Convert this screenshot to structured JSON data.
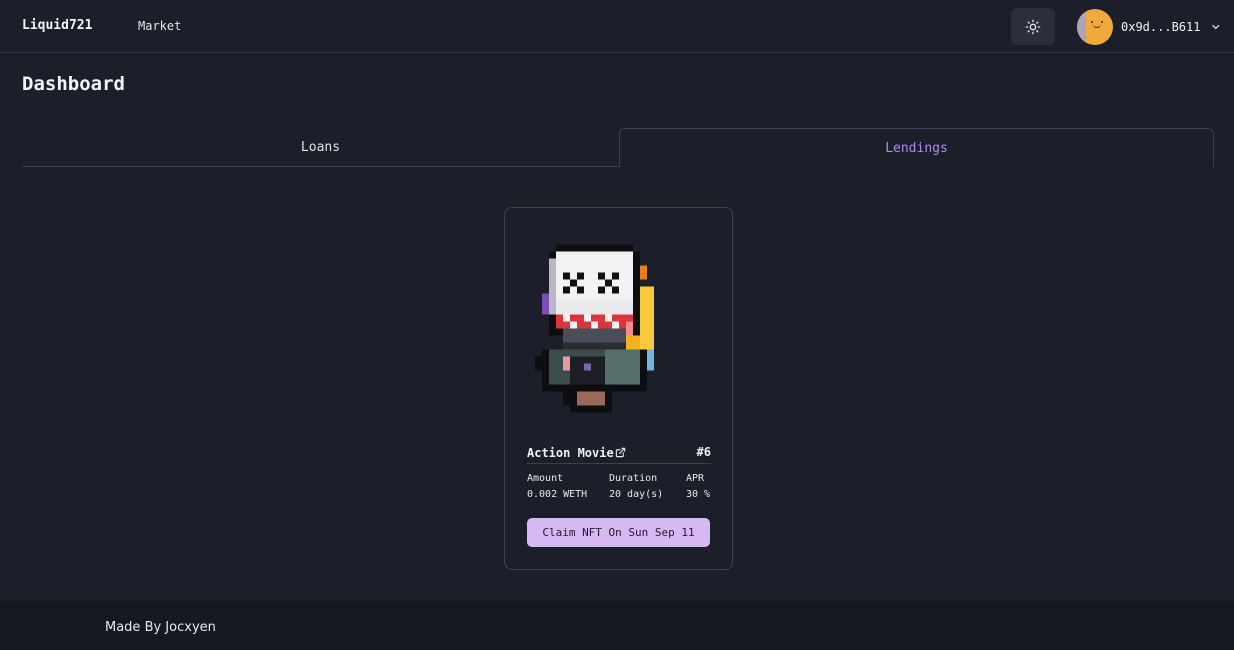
{
  "navbar": {
    "brand": "Liquid721",
    "links": [
      {
        "label": "Market"
      }
    ],
    "theme_toggle_icon": "sun-icon",
    "account": {
      "address": "0x9d...B611",
      "avatar_color": "#f2a93b"
    }
  },
  "page": {
    "title": "Dashboard"
  },
  "tabs": [
    {
      "label": "Loans",
      "active": false
    },
    {
      "label": "Lendings",
      "active": true
    }
  ],
  "accent_color": "#a88cf0",
  "card": {
    "name": "Action Movie",
    "id": "#6",
    "stats": [
      {
        "label": "Amount",
        "value": "0.002 WETH"
      },
      {
        "label": "Duration",
        "value": "20 day(s)"
      },
      {
        "label": "APR",
        "value": "30 %"
      }
    ],
    "button_label": "Claim NFT On Sun Sep 11",
    "button_color": "#d7b8f3"
  },
  "footer": {
    "text": "Made By Jocxyen"
  }
}
